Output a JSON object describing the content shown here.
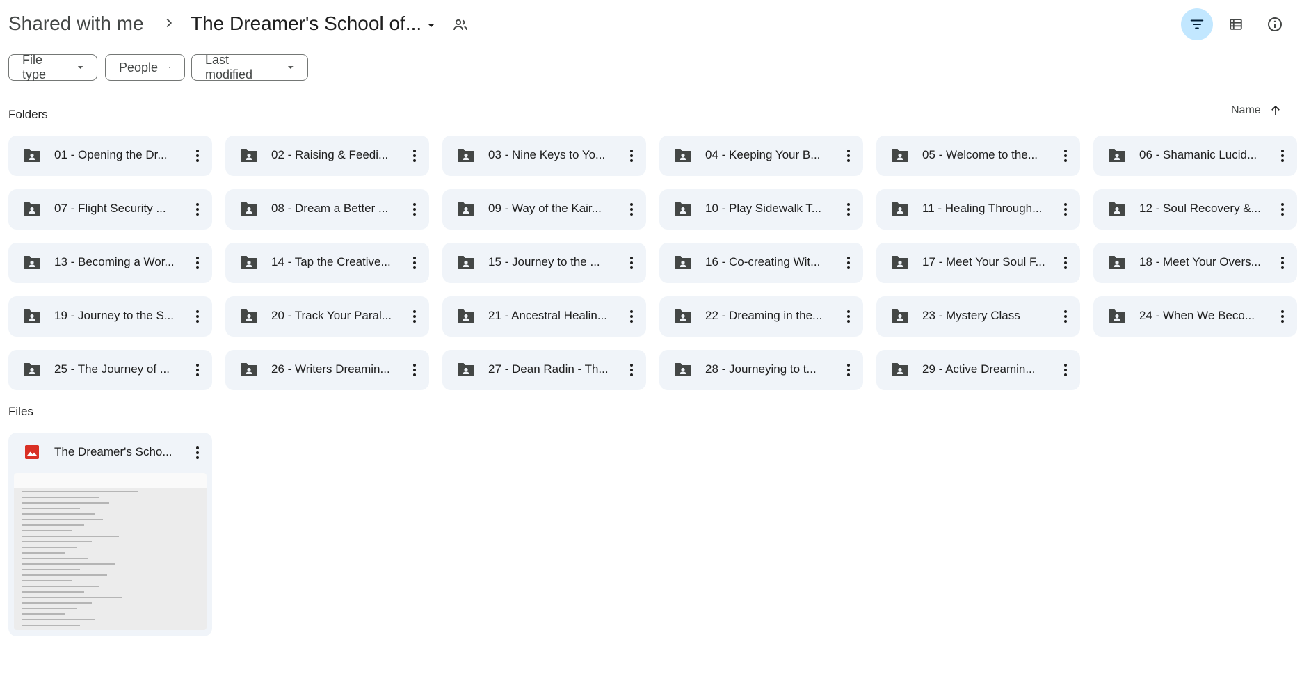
{
  "header": {
    "root_crumb": "Shared with me",
    "current_folder": "The Dreamer's School of..."
  },
  "filters": {
    "file_type": "File type",
    "people": "People",
    "last_modified": "Last modified"
  },
  "sections": {
    "folders_label": "Folders",
    "files_label": "Files",
    "sort_label": "Name"
  },
  "folders": [
    "01 - Opening the Dr...",
    "02 - Raising & Feedi...",
    "03 - Nine Keys to Yo...",
    "04 - Keeping Your B...",
    "05 - Welcome to the...",
    "06 - Shamanic Lucid...",
    "07 - Flight Security ...",
    "08 - Dream a Better ...",
    "09 - Way of the Kair...",
    "10 - Play Sidewalk T...",
    "11 - Healing Through...",
    "12 - Soul Recovery &...",
    "13 - Becoming a Wor...",
    "14 - Tap the Creative...",
    "15 - Journey to the ...",
    "16 - Co-creating Wit...",
    "17 - Meet Your Soul F...",
    "18 - Meet Your Overs...",
    "19 - Journey to the S...",
    "20 - Track Your Paral...",
    "21 - Ancestral Healin...",
    "22 - Dreaming in the...",
    "23 - Mystery Class",
    "24 - When We Beco...",
    "25 - The Journey of ...",
    "26 - Writers Dreamin...",
    "27 - Dean Radin - Th...",
    "28 - Journeying to t...",
    "29 - Active Dreamin..."
  ],
  "files": [
    {
      "name": "The Dreamer's Scho...",
      "icon": "image-icon"
    }
  ],
  "colors": {
    "accent_active": "#c2e7ff",
    "card_bg": "#f0f4f9",
    "image_icon": "#d93025"
  }
}
